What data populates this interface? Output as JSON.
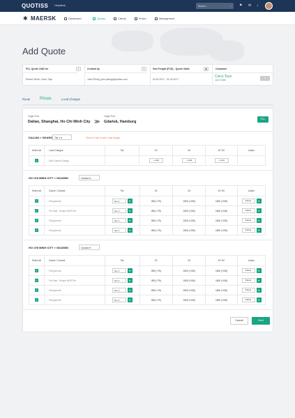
{
  "topbar": {
    "logo": "QUOTISS",
    "helpdesk": "Helpdesk",
    "search_placeholder": "Search..."
  },
  "secondary": {
    "brand": "MAERSK",
    "nav": [
      "Dashboard",
      "Quotes",
      "Clients",
      "Prices",
      "Management"
    ]
  },
  "page_title": "Add Quote",
  "info": {
    "headers": [
      "FCL Quote #462 for",
      "Created by",
      "Sea Freight (FCD) - Quote Valid:",
      "Customer"
    ],
    "values": [
      "Robert Smith, Cisco Toys",
      "John Pilong, john.pilong@quotiss.com",
      "04.01.2017 - 01.01.2017"
    ],
    "customer": "Cisco Toys",
    "customer_contact": "John Smith"
  },
  "tabs": {
    "route": "Route",
    "prices": "Prices",
    "local_charges": "Local Charges"
  },
  "ports": {
    "origin_label": "Origin Port",
    "origin": "Dalian, Shanghai, Ho Chi Minh City",
    "dest_label": "Origin Port",
    "dest": "Gdańsk, Hamburg",
    "arrow": "≫",
    "fcl": "FCL"
  },
  "headers": {
    "select_all": "Select all",
    "local_charges": "Local Charges",
    "career": "Career / Contact",
    "tier": "Tier",
    "c20": "20'",
    "c40": "40'",
    "c40hc": "40' HC",
    "action": "Action"
  },
  "route1": {
    "from": "DALIAN",
    "to": "GDAŃSK",
    "select": "Tier 1",
    "hint": "Check or tick to add Local charge",
    "row": "Add Custom Charge",
    "add": "+ Add"
  },
  "route2": {
    "from": "HO CHI MINH CITY",
    "to": "GDAŃSK",
    "select": "Custom",
    "rows": [
      {
        "name": "FAA general",
        "tier": "Tier C"
      },
      {
        "name": "Far East - Europe NDR.Tier",
        "tier": "Tier C"
      },
      {
        "name": "FAA general",
        "tier": "Tier C"
      },
      {
        "name": "FAA general",
        "tier": "Tier C"
      }
    ]
  },
  "route3": {
    "from": "HO CHI MINH CITY",
    "to": "GDAŃSK",
    "select": "Custom",
    "rows": [
      {
        "name": "FAA general",
        "tier": "Tier C"
      },
      {
        "name": "Far East - Europe NDR.Tier",
        "tier": "Tier C"
      },
      {
        "name": "FAA general",
        "tier": "Tier C"
      },
      {
        "name": "FAA general",
        "tier": "Tier C"
      }
    ]
  },
  "prices": {
    "c20": "850 (+75)",
    "c40": "1500 (+150)",
    "c40hc": "1600 (+150)"
  },
  "delete": "Delete",
  "footer": {
    "cancel": "Cancel",
    "next": "Next"
  }
}
